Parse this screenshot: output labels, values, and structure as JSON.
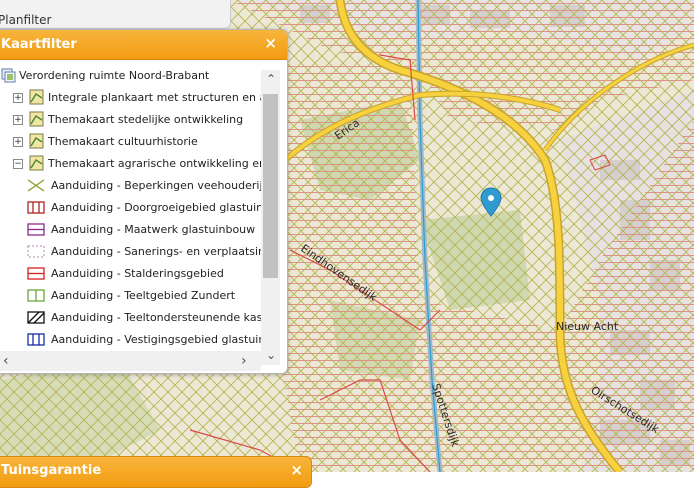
{
  "planfilter_tab": {
    "label": "Planfilter"
  },
  "kaartfilter": {
    "title": "Kaartfilter",
    "close": "×",
    "root": {
      "label": "Verordening ruimte Noord-Brabant",
      "icon": "folder-layers-icon"
    },
    "groups": [
      {
        "label": "Integrale plankaart met structuren en aand",
        "expander": "+"
      },
      {
        "label": "Themakaart stedelijke ontwikkeling",
        "expander": "+"
      },
      {
        "label": "Themakaart cultuurhistorie",
        "expander": "+"
      },
      {
        "label": "Themakaart agrarische ontwikkeling en win",
        "expander": "−"
      }
    ],
    "legend_items": [
      {
        "label": "Aanduiding - Beperkingen veehouderij",
        "icon": "crosshatch-olive-icon"
      },
      {
        "label": "Aanduiding - Doorgroeigebied glastuinbouw",
        "icon": "vertical-stripes-red-icon"
      },
      {
        "label": "Aanduiding - Maatwerk glastuinbouw",
        "icon": "horizontal-stripes-purple-icon"
      },
      {
        "label": "Aanduiding - Sanerings- en verplaatsingsloc",
        "icon": "dashed-outline-purple-icon"
      },
      {
        "label": "Aanduiding - Stalderingsgebied",
        "icon": "horizontal-stripes-red-icon"
      },
      {
        "label": "Aanduiding - Teeltgebied Zundert",
        "icon": "grid-green-icon"
      },
      {
        "label": "Aanduiding - Teeltondersteunende kassen",
        "icon": "diagonal-stripes-black-icon"
      },
      {
        "label": "Aanduiding - Vestigingsgebied glastuinbouw",
        "icon": "vertical-stripes-blue-icon"
      }
    ]
  },
  "bottom_panel": {
    "title": "Tuinsgarantie",
    "close": "×"
  },
  "map_labels": {
    "erica": "Erica",
    "eindhovenseweg": "Eindhovensedijk",
    "nieuw_acht": "Nieuw Acht",
    "strijpseweg": "Spottersdijk",
    "oirschotseweg": "Oirschotsedijk"
  },
  "colors": {
    "header": "#f39c12",
    "road": "#f7d23e",
    "hatch_red": "#e8a0a0",
    "hatch_olive": "#a8b34a",
    "marker": "#2f9bd0"
  }
}
